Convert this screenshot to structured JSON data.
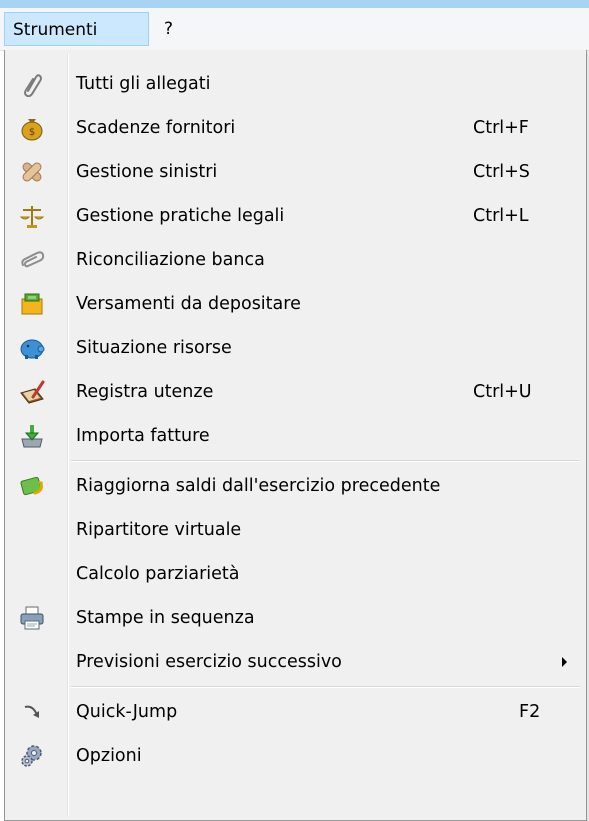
{
  "menubar": {
    "strumenti": "Strumenti",
    "help": "?"
  },
  "menu": {
    "items": [
      {
        "label": "Tutti gli allegati",
        "shortcut": "",
        "icon": "paperclip-icon"
      },
      {
        "label": "Scadenze fornitori",
        "shortcut": "Ctrl+F",
        "icon": "money-bag-icon"
      },
      {
        "label": "Gestione sinistri",
        "shortcut": "Ctrl+S",
        "icon": "bandage-icon"
      },
      {
        "label": "Gestione pratiche legali",
        "shortcut": "Ctrl+L",
        "icon": "scales-icon"
      },
      {
        "label": "Riconciliazione banca",
        "shortcut": "",
        "icon": "paperclip-link-icon"
      },
      {
        "label": "Versamenti da depositare",
        "shortcut": "",
        "icon": "money-box-icon"
      },
      {
        "label": "Situazione risorse",
        "shortcut": "",
        "icon": "piggy-bank-icon"
      },
      {
        "label": "Registra utenze",
        "shortcut": "Ctrl+U",
        "icon": "notebook-pen-icon"
      },
      {
        "label": "Importa fatture",
        "shortcut": "",
        "icon": "import-tray-icon"
      },
      {
        "label": "Riaggiorna saldi dall'esercizio precedente",
        "shortcut": "",
        "icon": "refresh-money-icon"
      },
      {
        "label": "Ripartitore virtuale",
        "shortcut": "",
        "icon": ""
      },
      {
        "label": "Calcolo parziarietà",
        "shortcut": "",
        "icon": ""
      },
      {
        "label": "Stampe in sequenza",
        "shortcut": "",
        "icon": "printer-icon"
      },
      {
        "label": "Previsioni esercizio successivo",
        "shortcut": "",
        "icon": "",
        "submenu": true
      },
      {
        "label": "Quick-Jump",
        "shortcut": "F2",
        "icon": "jump-arrow-icon"
      },
      {
        "label": "Opzioni",
        "shortcut": "",
        "icon": "gears-icon"
      }
    ]
  }
}
